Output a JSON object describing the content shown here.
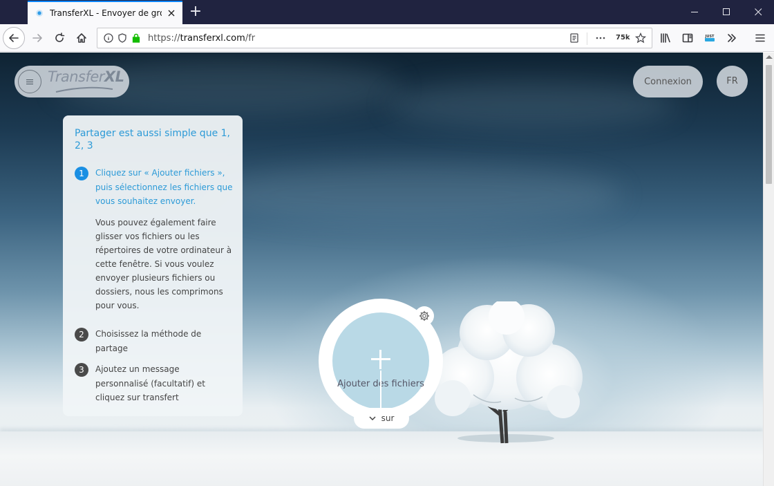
{
  "browser": {
    "tab_title": "TransferXL - Envoyer de gros fic",
    "url_scheme": "https://",
    "url_host": "transferxl.com",
    "url_path": "/fr",
    "zoom_badge": "75k"
  },
  "header": {
    "logo_text": "Transfer",
    "logo_text_bold": "XL",
    "connexion_label": "Connexion",
    "language_label": "FR"
  },
  "card": {
    "title": "Partager est aussi simple que 1, 2, 3",
    "steps": [
      {
        "number": "1",
        "text": "Cliquez sur « Ajouter fichiers », puis sélectionnez les fichiers que vous souhaitez envoyer.",
        "subtext": "Vous pouvez également faire glisser vos fichiers ou les répertoires de votre ordinateur à cette fenêtre. Si vous voulez envoyer plusieurs fichiers ou dossiers, nous les comprimons pour vous."
      },
      {
        "number": "2",
        "text": "Choisissez la méthode de partage"
      },
      {
        "number": "3",
        "text": "Ajoutez un message personnalisé (facultatif) et cliquez sur transfert"
      }
    ]
  },
  "upload": {
    "label": "Ajouter des fichiers",
    "more_label": "sur"
  },
  "colors": {
    "accent": "#2c9ad7",
    "step_active": "#1a8fe3",
    "upload_fill": "#b9d9e6",
    "titlebar": "#202340"
  },
  "icons": [
    "back-icon",
    "forward-icon",
    "reload-icon",
    "home-icon",
    "info-icon",
    "shield-icon",
    "lock-icon",
    "reader-view-icon",
    "more-actions-icon",
    "bookmark-star-icon",
    "library-icon",
    "sidebar-icon",
    "overflow-icon",
    "hamburger-menu-icon",
    "settings-gear-icon",
    "chevron-down-icon"
  ]
}
